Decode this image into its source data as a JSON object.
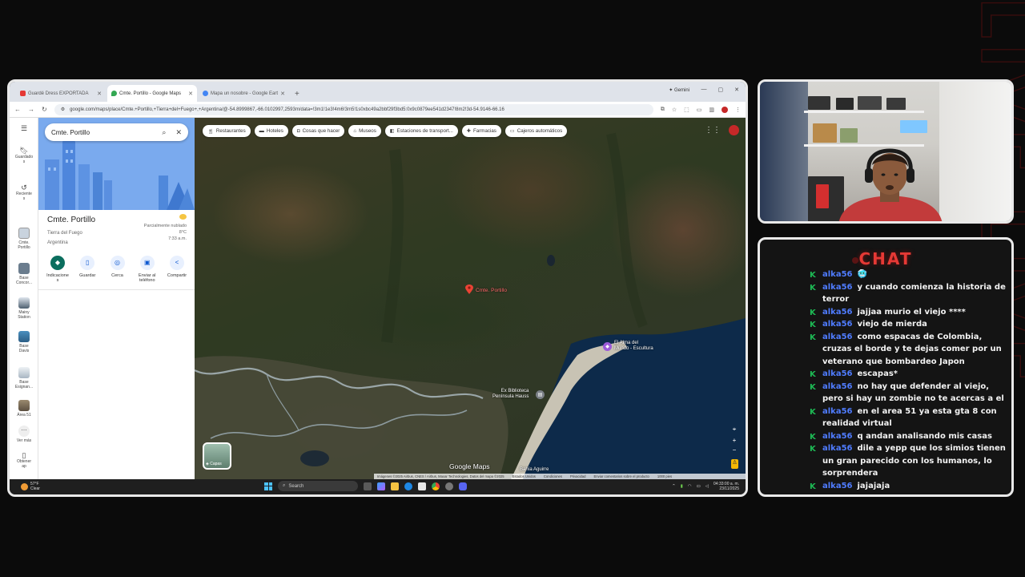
{
  "browser": {
    "tabs": [
      {
        "title": "Guardé Dress EXPORTADA",
        "favicon_color": "#e53935"
      },
      {
        "title": "Cmte. Portillo - Google Maps",
        "favicon_color": "#34a853"
      },
      {
        "title": "Mapa un nosobre - Google Eart",
        "favicon_color": "#4285f4"
      }
    ],
    "gemini_label": "Gemini",
    "url": "google.com/maps/place/Cmte.+Portillo,+Tierra+del+Fuego+,+Argentina/@-54.8999867,-66.0102997,2593m/data=!3m1!1e3!4m6!3m5!1s0xbc49a2bbf29f3bd5:0x9c0879ee541d2347!8m2!3d-54.9146-66.16"
  },
  "rail": {
    "menu_icon": "menu-icon",
    "items": [
      {
        "label": "Guardado\ns",
        "icon": "bookmark-icon"
      },
      {
        "label": "Reciente\ns",
        "icon": "history-icon"
      },
      {
        "label": "Cmte.\nPortillo"
      },
      {
        "label": "Base\nConcor..."
      },
      {
        "label": "Mainy\nStation"
      },
      {
        "label": "Base\nDavis"
      },
      {
        "label": "Base\nEsignan..."
      },
      {
        "label": "Área 51"
      },
      {
        "label": "Ver más"
      },
      {
        "label": "Obtener\nap"
      }
    ]
  },
  "panel": {
    "search_value": "Cmte. Portillo",
    "place_name": "Cmte. Portillo",
    "region": "Tierra del Fuego",
    "country": "Argentina",
    "weather": {
      "condition": "Parcialmente nublado",
      "temp": "8°C",
      "time": "7:33 a.m."
    },
    "actions": [
      {
        "label": "Indicacione\ns",
        "icon": "directions-icon"
      },
      {
        "label": "Guardar",
        "icon": "bookmark-icon"
      },
      {
        "label": "Cerca",
        "icon": "nearby-icon"
      },
      {
        "label": "Enviar al\nteléfono",
        "icon": "phone-icon"
      },
      {
        "label": "Compartir",
        "icon": "share-icon"
      }
    ]
  },
  "map": {
    "chips": [
      "Restaurantes",
      "Hoteles",
      "Cosas que hacer",
      "Museos",
      "Estaciones de transport...",
      "Farmacias",
      "Cajeros automáticos"
    ],
    "pin_label": "Cmte. Portillo",
    "poi_1": "El Alma del\nMundo - Escultura",
    "poi_2": "Ex Biblioteca\nPenínsula Hauss",
    "bay_label": "Bahía Aguirre",
    "logo": "Google Maps",
    "layers_label": "Capas",
    "attribution": [
      "Imágenes ©2025 Airbus, CNES / Airbus, Maxar Technologies, Datos del mapa ©2025",
      "Estados Unidos",
      "Condiciones",
      "Privacidad",
      "Enviar comentarios sobre el producto",
      "1000 pies"
    ],
    "pin_color": "#ea4335"
  },
  "taskbar": {
    "temp": "57°F",
    "condition": "Clear",
    "search_placeholder": "Search",
    "time": "04:33:00 a. m.",
    "date": "23/11/2025"
  },
  "chat": {
    "title": "CHAT",
    "messages": [
      {
        "user": "alka56",
        "text": "🥶"
      },
      {
        "user": "alka56",
        "text": "y cuando comienza la historia de terror"
      },
      {
        "user": "alka56",
        "text": "jajjaa murio el viejo ****"
      },
      {
        "user": "alka56",
        "text": "viejo de mierda"
      },
      {
        "user": "alka56",
        "text": "como espacas de Colombia, cruzas el borde y te dejas comer por un veterano que bombardeo Japon"
      },
      {
        "user": "alka56",
        "text": "escapas*"
      },
      {
        "user": "alka56",
        "text": "no hay que defender al viejo, pero si hay un zombie no te acercas a el"
      },
      {
        "user": "alka56",
        "text": "en el area 51 ya esta gta 8 con realidad virtual"
      },
      {
        "user": "alka56",
        "text": "q andan analisando mis casas"
      },
      {
        "user": "alka56",
        "text": "dile a yepp que los simios tienen un gran parecido con los humanos, lo sorprendera"
      },
      {
        "user": "alka56",
        "text": "jajajaja"
      }
    ],
    "accent": "#e53935",
    "user_color": "#4f7cff",
    "badge_color": "#1db954"
  }
}
